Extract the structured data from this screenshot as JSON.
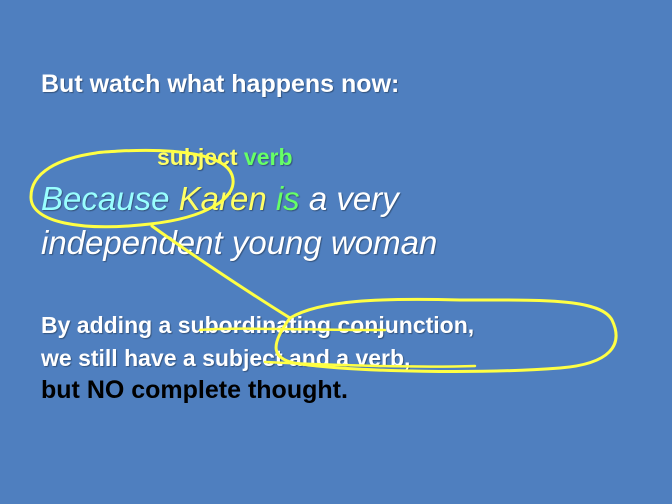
{
  "slide": {
    "heading": "But watch what happens now:",
    "labels": {
      "subject": "subject",
      "verb": "verb"
    },
    "sentence": {
      "because": "Because",
      "karen": "Karen",
      "is": "is",
      "rest_line1": "a very",
      "line2": "independent young woman"
    },
    "body": {
      "line1": "By adding a subordinating conjunction,",
      "line2": "we still have a subject and a verb,",
      "line3": "but NO complete thought."
    }
  },
  "colors": {
    "background": "#4f7fbf",
    "subject": "#ffff66",
    "verb": "#66ff66",
    "conjunction": "#99ffff",
    "annotation": "#ffff44"
  }
}
